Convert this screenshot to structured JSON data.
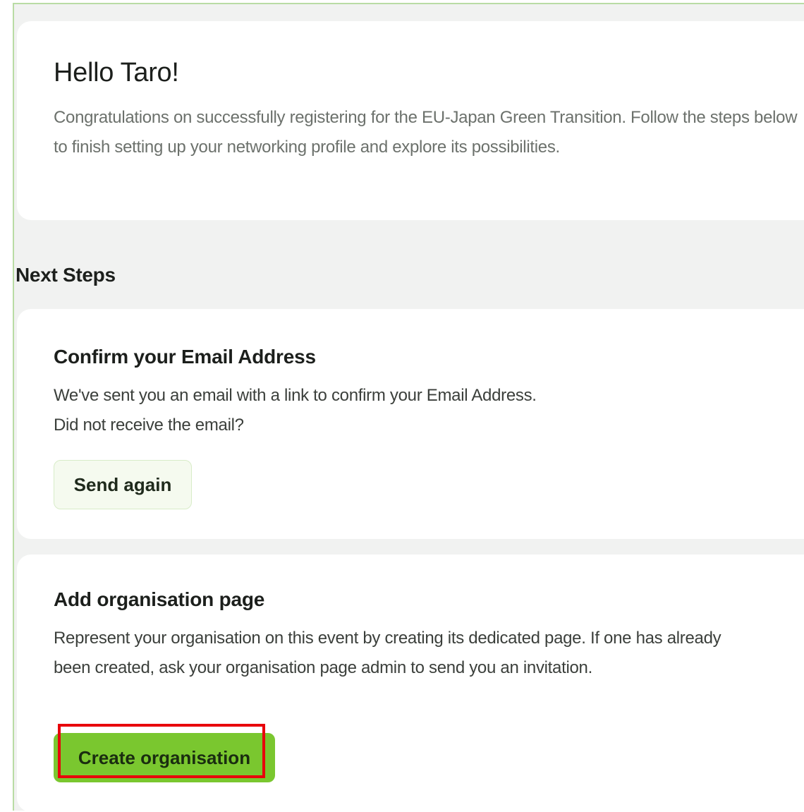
{
  "welcome": {
    "greeting": "Hello Taro!",
    "message": "Congratulations on successfully registering for the EU-Japan Green Transition. Follow the steps below to finish setting up your networking profile and explore its possibilities."
  },
  "next_steps": {
    "heading": "Next Steps",
    "confirm_email": {
      "title": "Confirm your Email Address",
      "line1": "We've sent you an email with a link to confirm your Email Address.",
      "line2": "Did not receive the email?",
      "button_label": "Send again"
    },
    "add_organisation": {
      "title": "Add organisation page",
      "description": "Represent your organisation on this event by creating its dedicated page. If one has already been created, ask your organisation page admin to send you an invitation.",
      "button_label": "Create organisation"
    }
  },
  "colors": {
    "primary_button": "#7ac72f",
    "highlight": "#e8000b",
    "frame_border": "#b9dca4"
  }
}
